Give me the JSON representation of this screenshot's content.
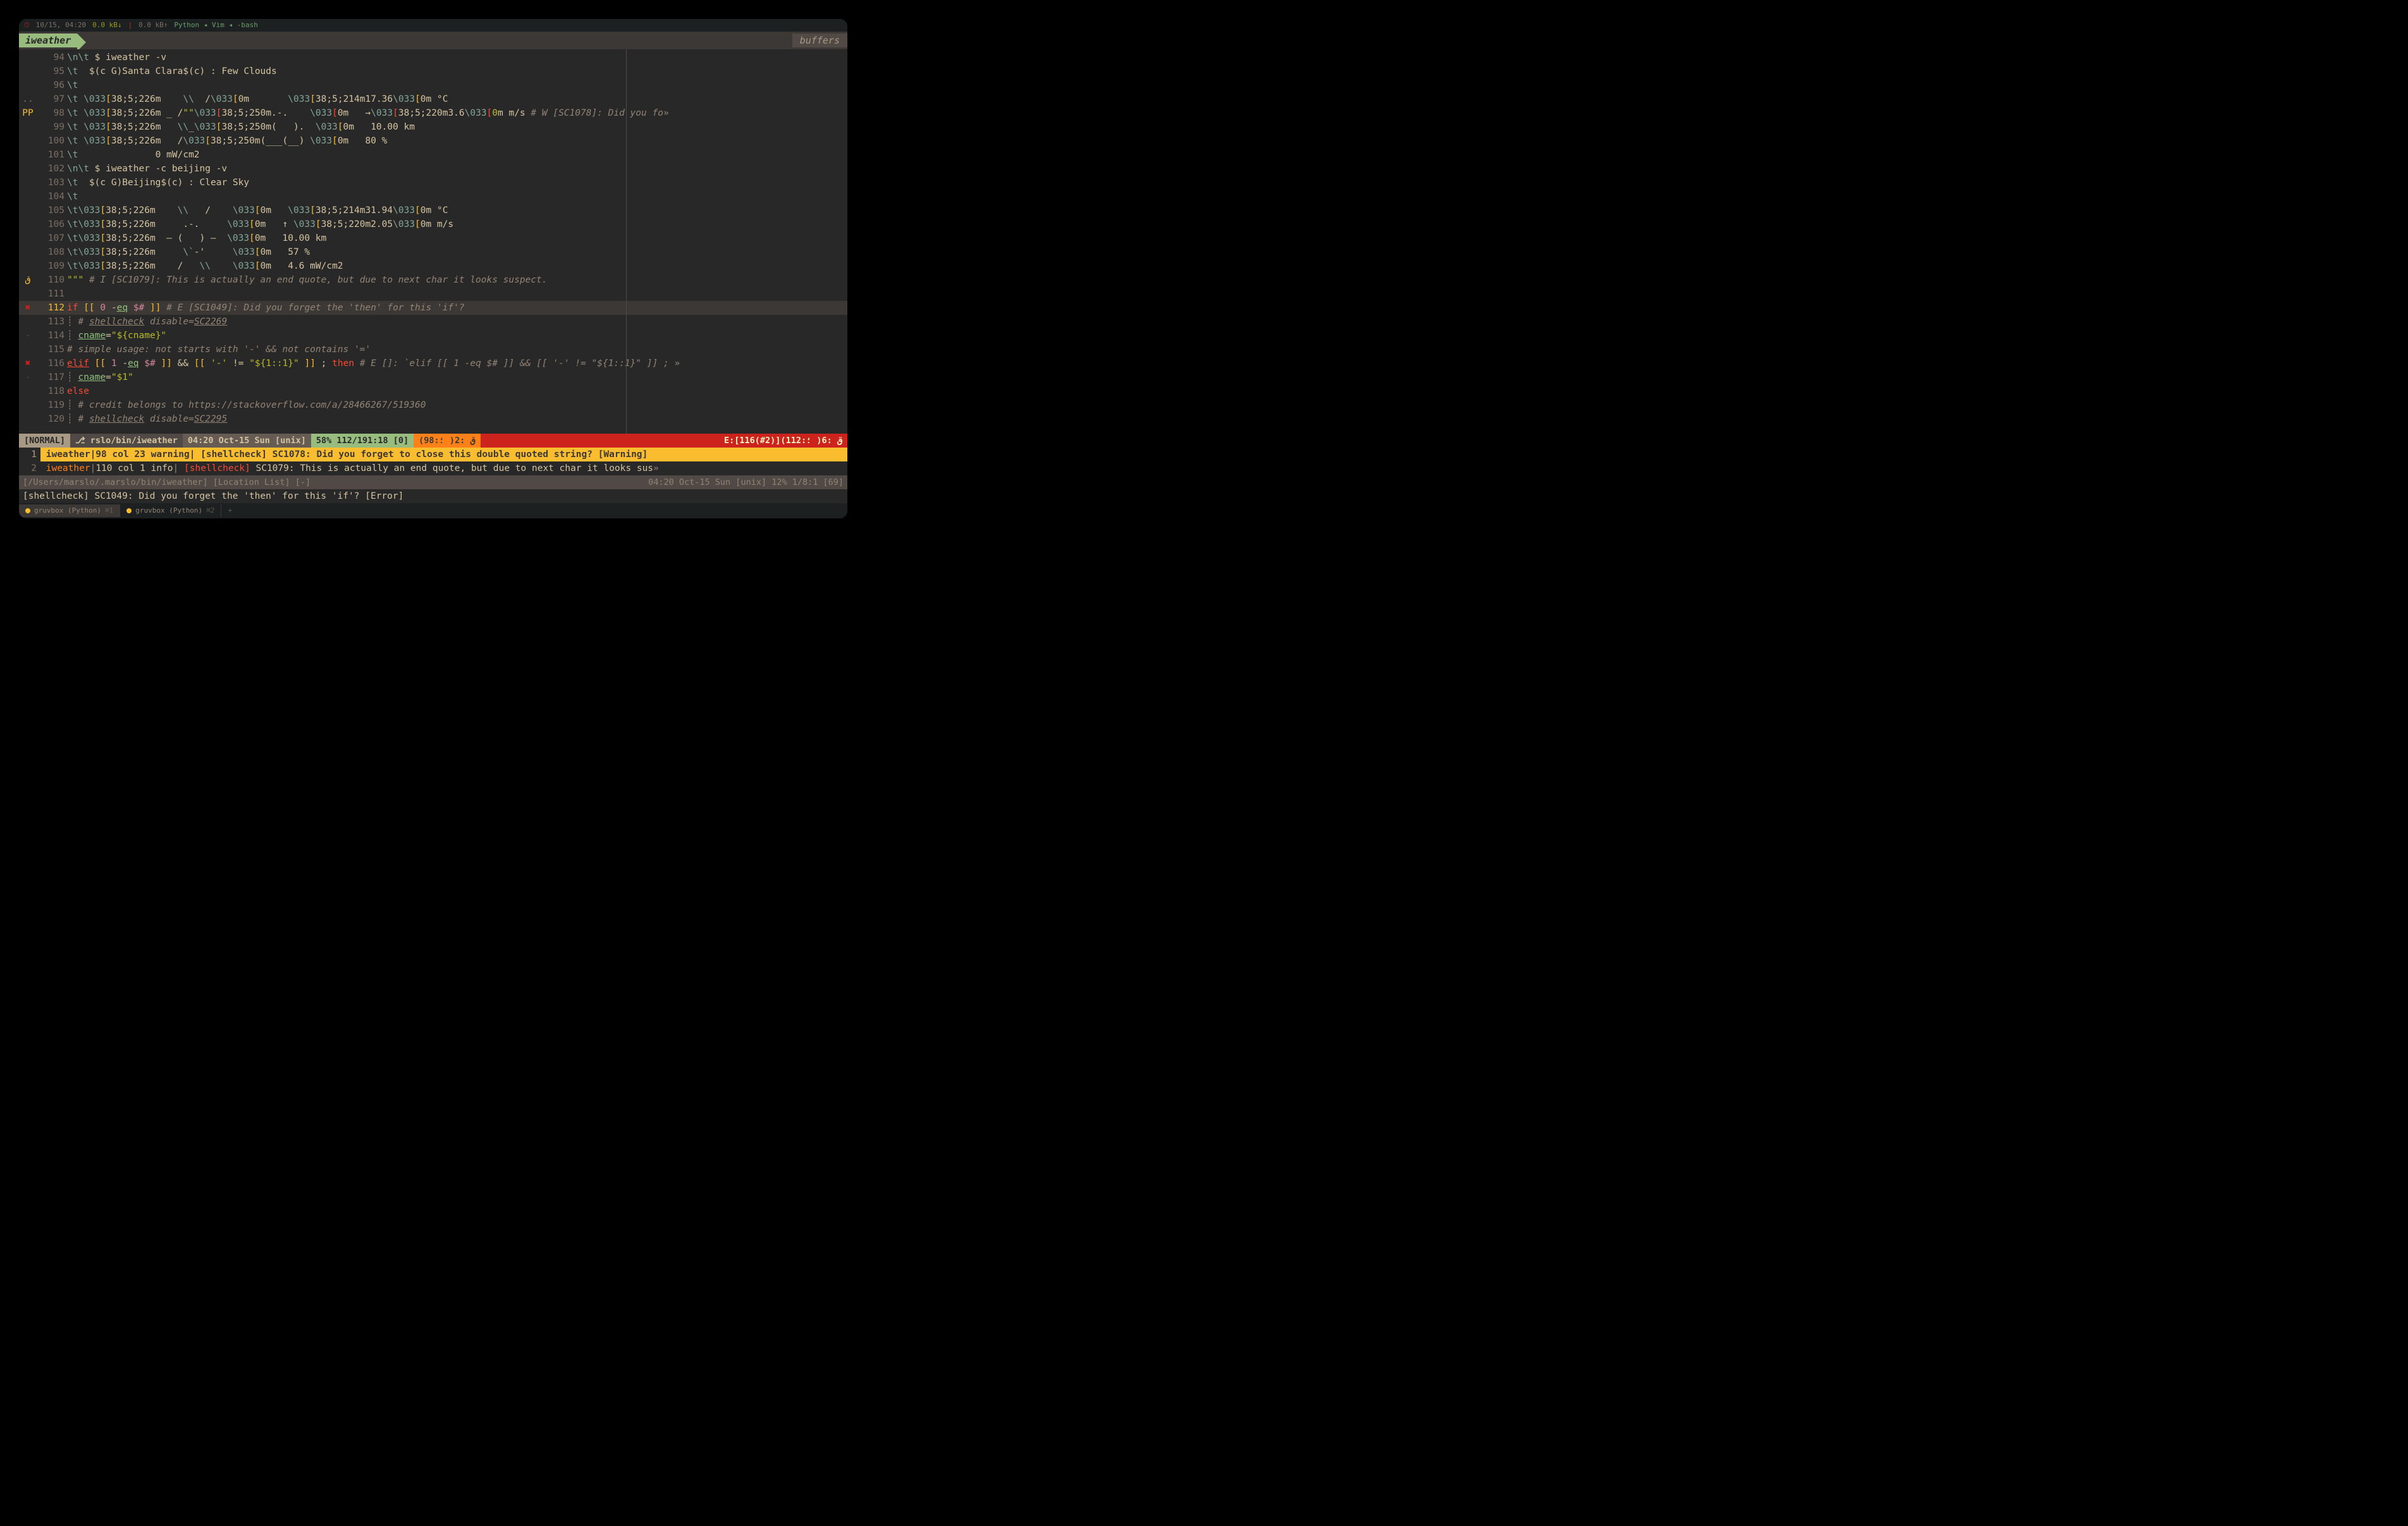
{
  "sysbar": {
    "clock": "10/15, 04:20",
    "netdown": "0.0 kB↓",
    "netup": "0.0 kB↑",
    "procs": "Python ◂ Vim ◂ -bash"
  },
  "tab": {
    "name": "iweather",
    "right": "buffers"
  },
  "lines": [
    {
      "n": "94",
      "sign": "",
      "html": "<span class='c-esc'>\\n\\t</span> $ iweather -v"
    },
    {
      "n": "95",
      "sign": "",
      "html": "<span class='c-esc'>\\t</span>  $(c G)Santa Clara$(c) : Few Clouds"
    },
    {
      "n": "96",
      "sign": "",
      "html": "<span class='c-esc'>\\t</span>"
    },
    {
      "n": "97",
      "sign": "..",
      "html": "<span class='c-esc'>\\t</span> <span class='c-esc'>\\033</span><span class='c-brkt'>[</span>38;5;226m    <span class='c-esc'>\\\\</span>  /<span class='c-esc'>\\033</span><span class='c-brkt'>[</span>0m       <span class='c-esc'>\\033</span><span class='c-brkt'>[</span>38;5;214m17.36<span class='c-esc'>\\033</span><span class='c-brkt'>[</span>0m °C"
    },
    {
      "n": "98",
      "sign": "PP",
      "signcls": "warn",
      "html": "<span class='c-esc'>\\t</span> <span class='c-esc'>\\033</span><span class='c-brkt'>[</span>38;5;226m _ /<span class='c-str'>\"\"</span><span class='c-esc'>\\033</span><span class='c-brktred'>[</span>38;5;250m.-.    <span class='c-esc'>\\033</span><span class='c-brktred'>[</span>0m   →<span class='c-esc'>\\033</span><span class='c-brktred'>[</span>38;5;220m3.6<span class='c-esc'>\\033</span><span class='c-brktred'>[</span><span class='c-str'>0</span>m m/s <span class='c-cmt'># W [SC1078]: Did you fo</span><span class='c-gray'>»</span>"
    },
    {
      "n": "99",
      "sign": "",
      "html": "<span class='c-esc'>\\t</span> <span class='c-esc'>\\033</span><span class='c-brkt'>[</span>38;5;226m   <span class='c-esc'>\\\\</span>_<span class='c-esc'>\\033</span><span class='c-brkt'>[</span>38;5;250m(   ).  <span class='c-esc'>\\033</span><span class='c-brkt'>[</span>0m   10.00 km"
    },
    {
      "n": "100",
      "sign": "",
      "html": "<span class='c-esc'>\\t</span> <span class='c-esc'>\\033</span><span class='c-brkt'>[</span>38;5;226m   /<span class='c-esc'>\\033</span><span class='c-brkt'>[</span>38;5;250m(___(__) <span class='c-esc'>\\033</span><span class='c-brkt'>[</span>0m   80 %"
    },
    {
      "n": "101",
      "sign": "",
      "html": "<span class='c-esc'>\\t</span>              0 mW/cm2"
    },
    {
      "n": "102",
      "sign": "",
      "html": "<span class='c-esc'>\\n\\t</span> $ iweather -c beijing -v"
    },
    {
      "n": "103",
      "sign": "",
      "html": "<span class='c-esc'>\\t</span>  $(c G)Beijing$(c) : Clear Sky"
    },
    {
      "n": "104",
      "sign": "",
      "html": "<span class='c-esc'>\\t</span>"
    },
    {
      "n": "105",
      "sign": "",
      "html": "<span class='c-esc'>\\t\\033</span><span class='c-brkt'>[</span>38;5;226m    <span class='c-esc'>\\\\</span>   /    <span class='c-esc'>\\033</span><span class='c-brkt'>[</span>0m   <span class='c-esc'>\\033</span><span class='c-brkt'>[</span>38;5;214m31.94<span class='c-esc'>\\033</span><span class='c-brkt'>[</span>0m °C"
    },
    {
      "n": "106",
      "sign": "",
      "html": "<span class='c-esc'>\\t\\033</span><span class='c-brkt'>[</span>38;5;226m     .-.     <span class='c-esc'>\\033</span><span class='c-brkt'>[</span>0m   ↑ <span class='c-esc'>\\033</span><span class='c-brkt'>[</span>38;5;220m2.05<span class='c-esc'>\\033</span><span class='c-brkt'>[</span>0m m/s"
    },
    {
      "n": "107",
      "sign": "",
      "html": "<span class='c-esc'>\\t\\033</span><span class='c-brkt'>[</span>38;5;226m  ― (   ) ―  <span class='c-esc'>\\033</span><span class='c-brkt'>[</span>0m   10.00 km"
    },
    {
      "n": "108",
      "sign": "",
      "html": "<span class='c-esc'>\\t\\033</span><span class='c-brkt'>[</span>38;5;226m     <span class='c-esc'>\\`</span>-'     <span class='c-esc'>\\033</span><span class='c-brkt'>[</span>0m   57 %"
    },
    {
      "n": "109",
      "sign": "",
      "html": "<span class='c-esc'>\\t\\033</span><span class='c-brkt'>[</span>38;5;226m    /   <span class='c-esc'>\\\\</span>    <span class='c-esc'>\\033</span><span class='c-brkt'>[</span>0m   4.6 mW/cm2"
    },
    {
      "n": "110",
      "sign": "ق",
      "signcls": "warn",
      "html": "<span class='c-str'>\"\"\"</span> <span class='c-cmt'># I [SC1079]: This is actually an end quote, but due to next char it looks suspect.</span>"
    },
    {
      "n": "111",
      "sign": "",
      "html": ""
    },
    {
      "n": "112",
      "sign": "✖",
      "signcls": "err",
      "cur": true,
      "html": "<span class='c-kw'>if</span> <span class='c-yel'>[[</span> <span class='c-mag'>0</span> -<span class='c-aqua c-und'>eq</span> <span class='c-mag'>$#</span> <span class='c-yel'>]]</span> <span class='c-cmt'># E [SC1049]: Did you forget the 'then' for this 'if'?</span>"
    },
    {
      "n": "113",
      "sign": "",
      "html": "<span class='c-gray'>┊</span> <span class='c-cmt'># <span class='c-und'>shellcheck</span> disable=<span class='c-und'>SC2269</span></span>"
    },
    {
      "n": "114",
      "sign": "-",
      "signcls": "change",
      "html": "<span class='c-gray'>┊</span> <span class='c-aqua c-und'>cname</span>=<span class='c-str'>\"${cname}\"</span>"
    },
    {
      "n": "115",
      "sign": "",
      "html": "<span class='c-cmt'># simple usage: not starts with '-' && not contains '='</span>"
    },
    {
      "n": "116",
      "sign": "✖",
      "signcls": "err",
      "html": "<span class='c-kw c-und'>elif</span> <span class='c-yel'>[[</span> <span class='c-mag'>1</span> -<span class='c-aqua c-und'>eq</span> <span class='c-mag'>$#</span> <span class='c-yel'>]]</span> && <span class='c-yel'>[[</span> <span class='c-str'>'-'</span> != <span class='c-str'>\"${1::1}\"</span> <span class='c-yel'>]]</span> ; <span class='c-kw'>then</span> <span class='c-cmt'># E []: `elif [[ 1 -eq $# ]] && [[ '-' != \"${1::1}\" ]] ; </span><span class='c-gray'>»</span>"
    },
    {
      "n": "117",
      "sign": "-",
      "signcls": "change",
      "html": "<span class='c-gray'>┊</span> <span class='c-aqua c-und'>cname</span>=<span class='c-str'>\"$1\"</span>"
    },
    {
      "n": "118",
      "sign": "",
      "html": "<span class='c-kw'>else</span>"
    },
    {
      "n": "119",
      "sign": "",
      "html": "<span class='c-gray'>┊</span> <span class='c-cmt'># credit belongs to https://stackoverflow.com/a/28466267/519360</span>"
    },
    {
      "n": "120",
      "sign": "",
      "html": "<span class='c-gray'>┊</span> <span class='c-cmt'># <span class='c-und'>shellcheck</span> disable=<span class='c-und'>SC2295</span></span>"
    }
  ],
  "statusline": {
    "mode": "[NORMAL]",
    "file": "⎇ rslo/bin/iweather",
    "time": "04:20 Oct-15 Sun [unix]",
    "pos": "58% 112/191:18 [0]",
    "warn": "ق :2( ؛:98)",
    "err": "E:[116(#2)]ق :6( ؛:112)"
  },
  "loclist": [
    {
      "n": "1",
      "sel": true,
      "text": "iweather|98 col 23 warning| [shellcheck] SC1078: Did you forget to close this double quoted string? [Warning]"
    },
    {
      "n": "2",
      "sel": false,
      "html": "<span class='c-orange'>iweather</span><span class='c-gray'>|</span>110 col 1 info<span class='c-gray'>|</span> <span class='c-red'>[shellcheck]</span> SC1079: This is actually an end quote, but due to next char it looks sus<span class='c-gray'>»</span>"
    }
  ],
  "locstatus": {
    "left": "[/Users/marslo/.marslo/bin/iweather] [Location List] [-]",
    "right": "04:20 Oct-15 Sun [unix]    12% 1/8:1 [69]"
  },
  "cmdline": "[shellcheck] SC1049: Did you forget the 'then' for this 'if'? [Error]",
  "bottomtabs": [
    {
      "label": "gruvbox (Python)",
      "kbd": "⌘1",
      "active": true
    },
    {
      "label": "gruvbox (Python)",
      "kbd": "⌘2",
      "active": false
    }
  ]
}
